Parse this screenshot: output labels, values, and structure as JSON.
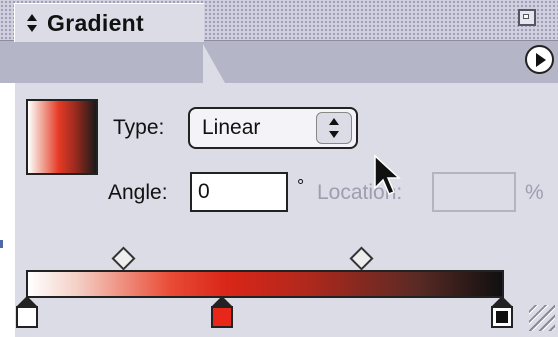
{
  "panel": {
    "title": "Gradient",
    "type_label": "Type:",
    "type_value": "Linear",
    "angle_label": "Angle:",
    "angle_value": "0",
    "degree_symbol": "°",
    "location_label": "Location:",
    "location_value": "",
    "percent_symbol": "%"
  },
  "gradient": {
    "stops": [
      {
        "name": "white-stop",
        "color": "#ffffff",
        "selected": false
      },
      {
        "name": "red-stop",
        "color": "#e8261a",
        "selected": false
      },
      {
        "name": "black-stop",
        "color": "#111111",
        "selected": true
      }
    ]
  },
  "icons": {
    "window_controls": [
      "window-box-icon",
      "window-box-icon"
    ],
    "tab": "up-down-arrows-icon",
    "menu": "triangle-right-icon",
    "select": "up-down-arrows-icon",
    "cursor": "mouse-pointer-icon",
    "resize": "resize-grip-icon"
  },
  "colors": {
    "panel_bg": "#dcdce6",
    "titlebar_bg": "#d0d0e0",
    "accent_red": "#e8261a",
    "disabled_text": "#9e9eb0"
  }
}
